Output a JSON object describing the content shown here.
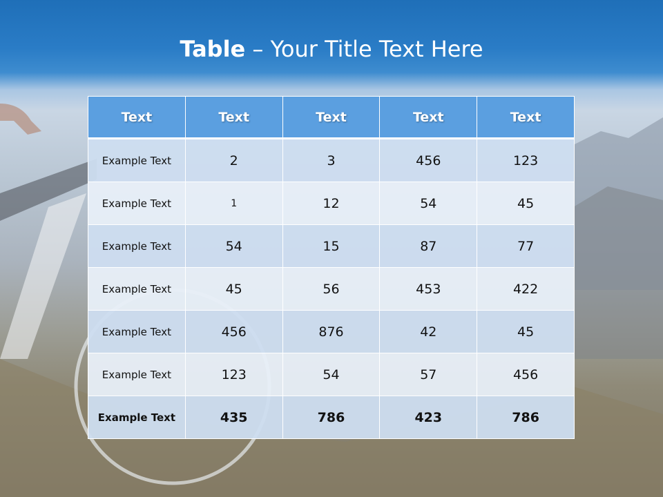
{
  "title": {
    "bold": "Table",
    "rest": " – Your Title Text Here"
  },
  "table": {
    "headers": [
      "Text",
      "Text",
      "Text",
      "Text",
      "Text"
    ],
    "rows": [
      [
        "Example Text",
        "2",
        "3",
        "456",
        "123"
      ],
      [
        "Example Text",
        "1",
        "12",
        "54",
        "45"
      ],
      [
        "Example Text",
        "54",
        "15",
        "87",
        "77"
      ],
      [
        "Example Text",
        "45",
        "56",
        "453",
        "422"
      ],
      [
        "Example Text",
        "456",
        "876",
        "42",
        "45"
      ],
      [
        "Example Text",
        "123",
        "54",
        "57",
        "456"
      ],
      [
        "Example Text",
        "435",
        "786",
        "423",
        "786"
      ]
    ]
  },
  "colors": {
    "header_bg": "#5b9fe0",
    "row_odd": "#cedcef",
    "row_even": "#e8eff8",
    "title_band": "#2a7cc6"
  }
}
